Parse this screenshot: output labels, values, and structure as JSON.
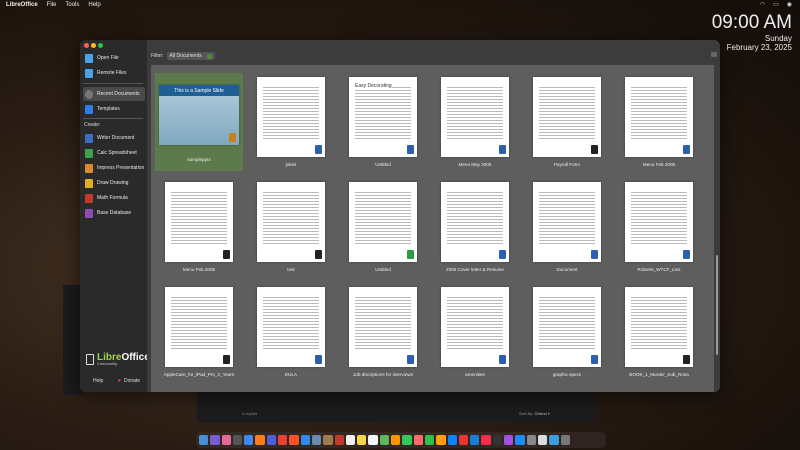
{
  "menubar": {
    "app": "LibreOffice",
    "items": [
      "File",
      "Tools",
      "Help"
    ]
  },
  "clock": {
    "time": "09:00 AM",
    "day": "Sunday",
    "date": "February 23, 2025"
  },
  "background_app": {
    "replies": "4 replies",
    "sort_label": "Sort By:",
    "sort_value": "Oldest"
  },
  "sidebar": {
    "open_file": "Open File",
    "remote_files": "Remote Files",
    "recent_documents": "Recent Documents",
    "templates": "Templates",
    "create_label": "Create:",
    "create_items": [
      {
        "label": "Writer Document",
        "color": "#3b6fc2"
      },
      {
        "label": "Calc Spreadsheet",
        "color": "#3aa34a"
      },
      {
        "label": "Impress Presentation",
        "color": "#d98a2b"
      },
      {
        "label": "Draw Drawing",
        "color": "#e0b020"
      },
      {
        "label": "Math Formula",
        "color": "#c0392b"
      },
      {
        "label": "Base Database",
        "color": "#8a4fb5"
      }
    ],
    "logo": {
      "libre": "Libre",
      "office": "Office",
      "community": "Community"
    },
    "help": "Help",
    "donate": "Donate"
  },
  "filter": {
    "label": "Filter:",
    "value": "All Documents"
  },
  "documents": [
    {
      "name": "samplepptx",
      "type": "impress",
      "selected": true,
      "slide_title": "This is a Sample Slide"
    },
    {
      "name": "jokes",
      "type": "writer"
    },
    {
      "name": "Untitled",
      "type": "writer",
      "heading": "Easy Decorating"
    },
    {
      "name": "Menu May 2005",
      "type": "writer"
    },
    {
      "name": "Payroll Form",
      "type": "generic"
    },
    {
      "name": "Menu Feb 2005",
      "type": "writer"
    },
    {
      "name": "Menu Feb 2005",
      "type": "generic"
    },
    {
      "name": "test",
      "type": "generic"
    },
    {
      "name": "Untitled",
      "type": "calc"
    },
    {
      "name": "2005 Cover letter & Resume",
      "type": "writer"
    },
    {
      "name": "Document",
      "type": "writer"
    },
    {
      "name": "Roberts_WTCF_Lies",
      "type": "writer"
    },
    {
      "name": "AppleCare_for_iPad_Pro_2_Years",
      "type": "generic"
    },
    {
      "name": "EULA",
      "type": "writer"
    },
    {
      "name": "Job discriptions for interviews",
      "type": "writer"
    },
    {
      "name": "amenities",
      "type": "writer"
    },
    {
      "name": "graphic specs",
      "type": "writer"
    },
    {
      "name": "BOOK_1_Murder_Sub_Rosa",
      "type": "generic"
    }
  ],
  "dock_colors": [
    "#4a90d9",
    "#7b5cd6",
    "#e86a9a",
    "#555",
    "#3d8af7",
    "#ff7a1a",
    "#4d5fe0",
    "#e94235",
    "#fb542b",
    "#2e8be8",
    "#6a8ab0",
    "#a07a50",
    "#c0392b",
    "#f0f0f0",
    "#f7d54a",
    "#f5f5f5",
    "#5cb85c",
    "#ff9500",
    "#34c759",
    "#ff6b6b",
    "#30c050",
    "#ff9f0a",
    "#0a84ff",
    "#e33",
    "#1c7ed6",
    "#fa2d48",
    "#333",
    "#a64ee0",
    "#1a8cff",
    "#888",
    "#ddd",
    "#3c9ee0",
    "#777"
  ]
}
